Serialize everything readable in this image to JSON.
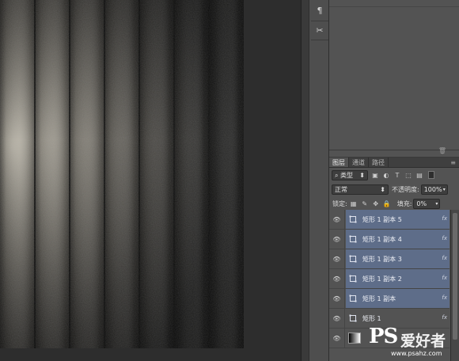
{
  "tool_strip": {
    "paragraph_icon": "¶",
    "crossed_tools_icon": "✂"
  },
  "layers_panel": {
    "tabs": [
      "图层",
      "通道",
      "路径"
    ],
    "active_tab": "图层",
    "filter_kind": "类型",
    "blend_mode": "正常",
    "opacity_label": "不透明度:",
    "opacity_value": "100%",
    "lock_label": "锁定:",
    "fill_label": "填充:",
    "fill_value": "0%",
    "layers": [
      {
        "name": "矩形 1 副本 5",
        "selected": true,
        "has_fx": true
      },
      {
        "name": "矩形 1 副本 4",
        "selected": true,
        "has_fx": true
      },
      {
        "name": "矩形 1 副本 3",
        "selected": true,
        "has_fx": true
      },
      {
        "name": "矩形 1 副本 2",
        "selected": true,
        "has_fx": true
      },
      {
        "name": "矩形 1 副本",
        "selected": true,
        "has_fx": true
      },
      {
        "name": "矩形 1",
        "selected": false,
        "has_fx": true
      }
    ]
  },
  "watermark": {
    "logo": "PS",
    "title": "爱好者",
    "url": "www.psahz.com"
  },
  "colors": {
    "selection": "#5e6d89",
    "panel": "#535353",
    "canvas_bg": "#2d2d2d"
  }
}
